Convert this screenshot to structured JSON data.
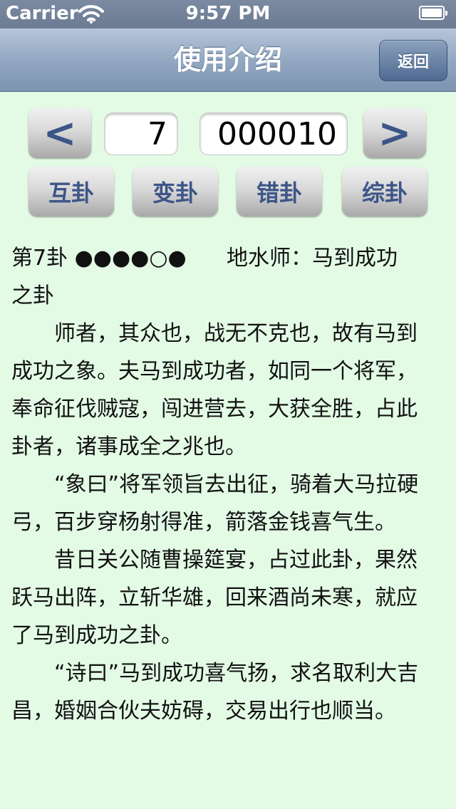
{
  "status": {
    "carrier": "Carrier",
    "time": "9:57 PM"
  },
  "nav": {
    "title": "使用介绍",
    "back_label": "返回"
  },
  "controls": {
    "prev_label": "<",
    "next_label": ">",
    "gua_number": "7",
    "binary_code": "000010",
    "buttons": [
      "互卦",
      "变卦",
      "错卦",
      "综卦"
    ]
  },
  "content": {
    "heading_left": "第7卦 ●●●●○●",
    "heading_right": "地水师：马到成功",
    "heading_cont": "之卦",
    "paragraphs": [
      "师者，其众也，战无不克也，故有马到成功之象。夫马到成功者，如同一个将军，奉命征伐贼寇，闯进营去，大获全胜，占此卦者，诸事成全之兆也。",
      "“象曰”将军领旨去出征，骑着大马拉硬弓，百步穿杨射得准，箭落金钱喜气生。",
      "昔日关公随曹操筵宴，占过此卦，果然跃马出阵，立斩华雄，回来酒尚未寒，就应了马到成功之卦。",
      "“诗曰”马到成功喜气扬，求名取利大吉昌，婚姻合伙夫妨碍，交易出行也顺当。"
    ]
  }
}
